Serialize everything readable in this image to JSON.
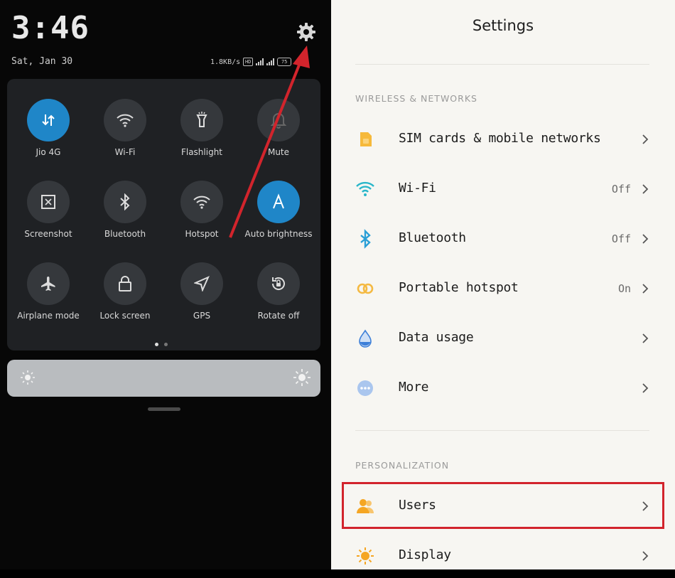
{
  "status_bar": {
    "time": "3:46",
    "date": "Sat, Jan 30",
    "speed": "1.8KB/s",
    "battery": "75"
  },
  "quick_settings": {
    "tiles": [
      {
        "label": "Jio 4G",
        "icon": "data-arrows-icon",
        "active": true
      },
      {
        "label": "Wi-Fi",
        "icon": "wifi-icon",
        "active": false
      },
      {
        "label": "Flashlight",
        "icon": "flashlight-icon",
        "active": false
      },
      {
        "label": "Mute",
        "icon": "bell-icon",
        "active": false
      },
      {
        "label": "Screenshot",
        "icon": "screenshot-icon",
        "active": false
      },
      {
        "label": "Bluetooth",
        "icon": "bluetooth-icon",
        "active": false
      },
      {
        "label": "Hotspot",
        "icon": "hotspot-icon",
        "active": false
      },
      {
        "label": "Auto brightness",
        "icon": "auto-brightness-icon",
        "active": true
      },
      {
        "label": "Airplane mode",
        "icon": "airplane-icon",
        "active": false
      },
      {
        "label": "Lock screen",
        "icon": "lock-icon",
        "active": false
      },
      {
        "label": "GPS",
        "icon": "gps-icon",
        "active": false
      },
      {
        "label": "Rotate off",
        "icon": "rotate-icon",
        "active": false
      }
    ],
    "page_dots": 2,
    "active_page": 1
  },
  "settings": {
    "title": "Settings",
    "sections": [
      {
        "header": "WIRELESS & NETWORKS",
        "items": [
          {
            "label": "SIM cards & mobile networks",
            "value": "",
            "icon": "sim-card-icon",
            "color": "#f6b93b"
          },
          {
            "label": "Wi-Fi",
            "value": "Off",
            "icon": "wifi-icon",
            "color": "#29b6c9"
          },
          {
            "label": "Bluetooth",
            "value": "Off",
            "icon": "bluetooth-icon",
            "color": "#2a9fd6"
          },
          {
            "label": "Portable hotspot",
            "value": "On",
            "icon": "hotspot-icon",
            "color": "#f4b942"
          },
          {
            "label": "Data usage",
            "value": "",
            "icon": "water-drop-icon",
            "color": "#3d7fd8"
          },
          {
            "label": "More",
            "value": "",
            "icon": "more-dots-icon",
            "color": "#4a90d9"
          }
        ]
      },
      {
        "header": "PERSONALIZATION",
        "items": [
          {
            "label": "Users",
            "value": "",
            "icon": "users-icon",
            "color": "#f5a623"
          },
          {
            "label": "Display",
            "value": "",
            "icon": "sun-icon",
            "color": "#f5a623"
          }
        ]
      }
    ]
  },
  "colors": {
    "highlight": "#d2242c",
    "arrow": "#d2242c",
    "tile_active": "#1f86c8"
  }
}
